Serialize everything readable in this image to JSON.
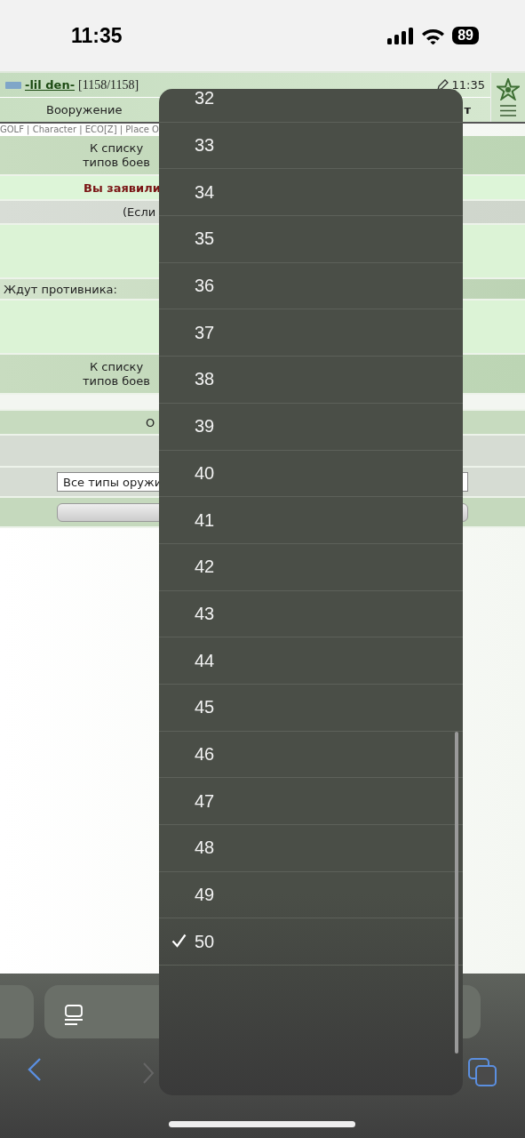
{
  "status_bar": {
    "time": "11:35",
    "battery": "89"
  },
  "header": {
    "user_name": "-lil den-",
    "hp": "[1158/1158]",
    "time": "11:35"
  },
  "tabs": [
    {
      "label": "Вооружение",
      "kind": "normal"
    },
    {
      "label": "т",
      "kind": "bold"
    }
  ],
  "links": "GOLF | Character | ECO[Z] | Place O",
  "rows": [
    {
      "kind": "link",
      "text": "К списку\nтипов боев"
    },
    {
      "kind": "notice",
      "text": "Вы заявили"
    },
    {
      "kind": "hint",
      "text": "(Если"
    },
    {
      "kind": "blank"
    },
    {
      "kind": "label",
      "text": "Ждут противника:"
    },
    {
      "kind": "blank"
    },
    {
      "kind": "link",
      "text": "К списку\nтипов боев"
    },
    {
      "kind": "gap"
    },
    {
      "kind": "title",
      "text": "О"
    },
    {
      "kind": "grey"
    },
    {
      "kind": "select",
      "text": "Все типы оружи"
    },
    {
      "kind": "button"
    }
  ],
  "picker": [
    {
      "label": "32",
      "selected": false
    },
    {
      "label": "33",
      "selected": false
    },
    {
      "label": "34",
      "selected": false
    },
    {
      "label": "35",
      "selected": false
    },
    {
      "label": "36",
      "selected": false
    },
    {
      "label": "37",
      "selected": false
    },
    {
      "label": "38",
      "selected": false
    },
    {
      "label": "39",
      "selected": false
    },
    {
      "label": "40",
      "selected": false
    },
    {
      "label": "41",
      "selected": false
    },
    {
      "label": "42",
      "selected": false
    },
    {
      "label": "43",
      "selected": false
    },
    {
      "label": "44",
      "selected": false
    },
    {
      "label": "45",
      "selected": false
    },
    {
      "label": "46",
      "selected": false
    },
    {
      "label": "47",
      "selected": false
    },
    {
      "label": "48",
      "selected": false
    },
    {
      "label": "49",
      "selected": false
    },
    {
      "label": "50",
      "selected": true
    }
  ]
}
